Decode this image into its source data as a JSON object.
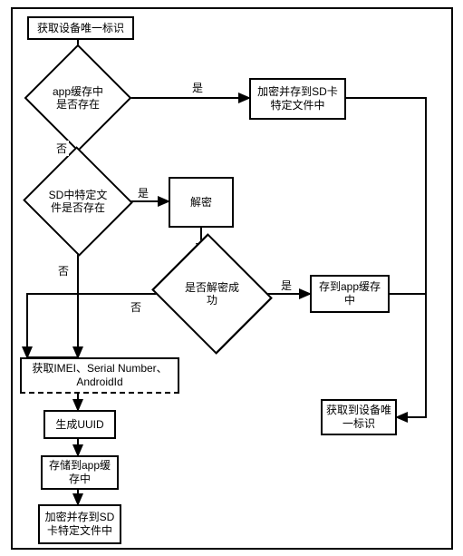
{
  "chart_data": {
    "type": "flowchart",
    "title": "",
    "nodes": [
      {
        "id": "n_start",
        "type": "process",
        "text": "获取设备唯一标识"
      },
      {
        "id": "d_cache",
        "type": "decision",
        "text": "app缓存中是否存在"
      },
      {
        "id": "n_enc_sd1",
        "type": "process",
        "text": "加密并存到SD卡特定文件中"
      },
      {
        "id": "d_sdfile",
        "type": "decision",
        "text": "SD中特定文件是否存在"
      },
      {
        "id": "n_decrypt",
        "type": "process",
        "text": "解密"
      },
      {
        "id": "d_decok",
        "type": "decision",
        "text": "是否解密成功"
      },
      {
        "id": "n_savecache",
        "type": "process",
        "text": "存到app缓存中"
      },
      {
        "id": "n_getids",
        "type": "process",
        "text": "获取IMEI、Serial Number、AndroidId"
      },
      {
        "id": "n_genuuid",
        "type": "process",
        "text": "生成UUID"
      },
      {
        "id": "n_store",
        "type": "process",
        "text": "存储到app缓存中"
      },
      {
        "id": "n_enc_sd2",
        "type": "process",
        "text": "加密并存到SD卡特定文件中"
      },
      {
        "id": "n_result",
        "type": "process",
        "text": "获取到设备唯一标识"
      }
    ],
    "edges": [
      {
        "from": "n_start",
        "to": "d_cache",
        "label": ""
      },
      {
        "from": "d_cache",
        "to": "n_enc_sd1",
        "label": "是"
      },
      {
        "from": "d_cache",
        "to": "d_sdfile",
        "label": "否"
      },
      {
        "from": "n_enc_sd1",
        "to": "n_result",
        "label": ""
      },
      {
        "from": "d_sdfile",
        "to": "n_decrypt",
        "label": "是"
      },
      {
        "from": "d_sdfile",
        "to": "n_getids",
        "label": "否"
      },
      {
        "from": "n_decrypt",
        "to": "d_decok",
        "label": ""
      },
      {
        "from": "d_decok",
        "to": "n_savecache",
        "label": "是"
      },
      {
        "from": "d_decok",
        "to": "n_getids",
        "label": "否"
      },
      {
        "from": "n_savecache",
        "to": "n_result",
        "label": ""
      },
      {
        "from": "n_getids",
        "to": "n_genuuid",
        "label": ""
      },
      {
        "from": "n_genuuid",
        "to": "n_store",
        "label": ""
      },
      {
        "from": "n_store",
        "to": "n_enc_sd2",
        "label": ""
      }
    ],
    "edge_labels": {
      "yes": "是",
      "no": "否"
    }
  },
  "nodes": {
    "start": "获取设备唯一标识",
    "d_cache": "app缓存中是否存在",
    "enc_sd1": "加密并存到SD卡特定文件中",
    "d_sdfile": "SD中特定文件是否存在",
    "decrypt": "解密",
    "d_decok": "是否解密成功",
    "savecache": "存到app缓存中",
    "getids": "获取IMEI、Serial Number、AndroidId",
    "genuuid": "生成UUID",
    "store": "存储到app缓存中",
    "enc_sd2": "加密并存到SD卡特定文件中",
    "result": "获取到设备唯一标识"
  },
  "labels": {
    "yes": "是",
    "no": "否"
  }
}
